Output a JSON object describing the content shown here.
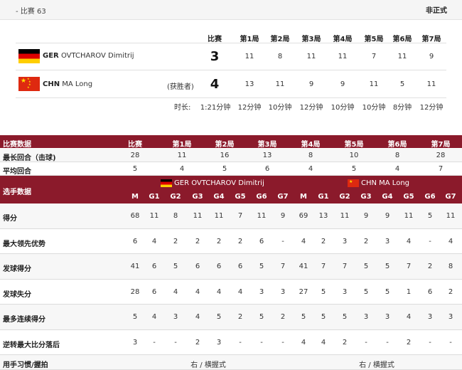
{
  "topbar": {
    "crumb": "- 比赛 63",
    "status": "非正式"
  },
  "scorecard": {
    "headers": [
      "比赛",
      "第1局",
      "第2局",
      "第3局",
      "第4局",
      "第5局",
      "第6局",
      "第7局"
    ],
    "players": [
      {
        "flag": "germany-flag",
        "noc": "GER",
        "name": "OVTCHAROV Dimitrij",
        "winner_label": "",
        "total": "3",
        "games": [
          "11",
          "8",
          "11",
          "11",
          "7",
          "11",
          "9"
        ]
      },
      {
        "flag": "china-flag",
        "noc": "CHN",
        "name": "MA Long",
        "winner_label": "(获胜者)",
        "total": "4",
        "games": [
          "13",
          "11",
          "9",
          "9",
          "11",
          "5",
          "11"
        ]
      }
    ],
    "duration_label": "时长:",
    "durations": [
      "1:21分钟",
      "12分钟",
      "10分钟",
      "12分钟",
      "10分钟",
      "10分钟",
      "8分钟",
      "12分钟"
    ]
  },
  "match_stats": {
    "title": "比赛数据",
    "headers": [
      "比赛",
      "第1局",
      "第2局",
      "第3局",
      "第4局",
      "第5局",
      "第6局",
      "第7局"
    ],
    "rows": [
      {
        "label": "最长回合（击球)",
        "values": [
          "28",
          "11",
          "16",
          "13",
          "8",
          "10",
          "8",
          "28"
        ]
      },
      {
        "label": "平均回合",
        "values": [
          "5",
          "4",
          "5",
          "6",
          "4",
          "5",
          "4",
          "7"
        ]
      }
    ]
  },
  "player_stats": {
    "title": "选手数据",
    "player1": "GER OVTCHAROV Dimitrij",
    "player2": "CHN MA Long",
    "subheaders": [
      "M",
      "G1",
      "G2",
      "G3",
      "G4",
      "G5",
      "G6",
      "G7",
      "M",
      "G1",
      "G2",
      "G3",
      "G4",
      "G5",
      "G6",
      "G7"
    ],
    "rows": [
      {
        "label": "得分",
        "values": [
          "68",
          "11",
          "8",
          "11",
          "11",
          "7",
          "11",
          "9",
          "69",
          "13",
          "11",
          "9",
          "9",
          "11",
          "5",
          "11"
        ]
      },
      {
        "label": "最大领先优势",
        "values": [
          "6",
          "4",
          "2",
          "2",
          "2",
          "2",
          "6",
          "-",
          "4",
          "2",
          "3",
          "2",
          "3",
          "4",
          "-",
          "4"
        ]
      },
      {
        "label": "发球得分",
        "values": [
          "41",
          "6",
          "5",
          "6",
          "6",
          "6",
          "5",
          "7",
          "41",
          "7",
          "7",
          "5",
          "5",
          "7",
          "2",
          "8"
        ]
      },
      {
        "label": "发球失分",
        "values": [
          "28",
          "6",
          "4",
          "4",
          "4",
          "4",
          "3",
          "3",
          "27",
          "5",
          "3",
          "5",
          "5",
          "1",
          "6",
          "2"
        ]
      },
      {
        "label": "最多连续得分",
        "values": [
          "5",
          "4",
          "3",
          "4",
          "5",
          "2",
          "5",
          "2",
          "5",
          "5",
          "5",
          "3",
          "3",
          "4",
          "3",
          "3"
        ]
      },
      {
        "label": "逆转最大比分落后",
        "values": [
          "3",
          "-",
          "-",
          "2",
          "3",
          "-",
          "-",
          "-",
          "4",
          "4",
          "2",
          "-",
          "-",
          "2",
          "-",
          "-"
        ]
      }
    ],
    "grip_label": "用手习惯/握拍",
    "grip_player1": "右 / 横握式",
    "grip_player2": "右 / 横握式"
  }
}
